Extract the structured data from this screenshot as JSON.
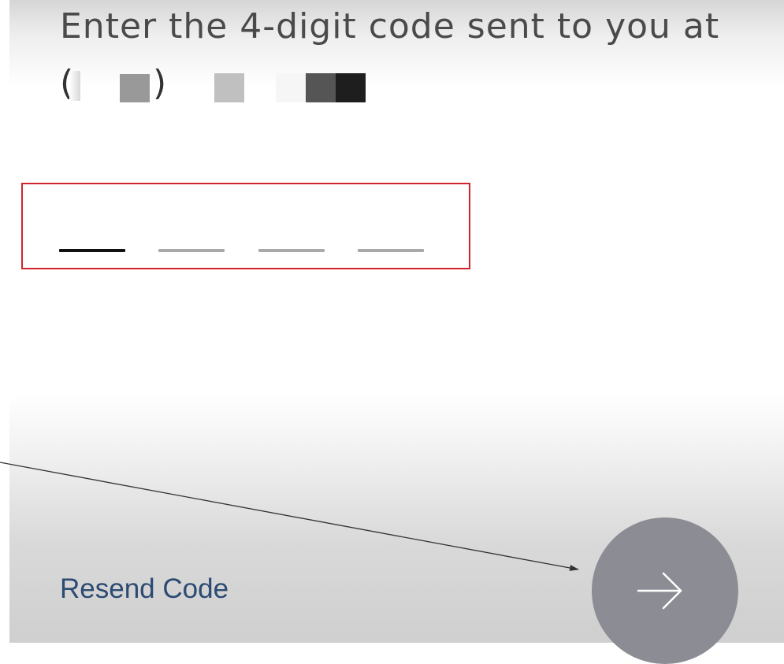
{
  "verification": {
    "prompt": "Enter the 4-digit code sent to you at",
    "phone": {
      "open_paren": "(",
      "close_paren": ")"
    },
    "code_length": 4,
    "active_slot": 1
  },
  "actions": {
    "resend_label": "Resend Code",
    "next_icon": "arrow-right-icon"
  },
  "colors": {
    "error_border": "#d0242c",
    "link": "#2c4a72",
    "next_button": "#8c8c94",
    "slot_active": "#111111",
    "slot_inactive": "#a9a9a9"
  }
}
